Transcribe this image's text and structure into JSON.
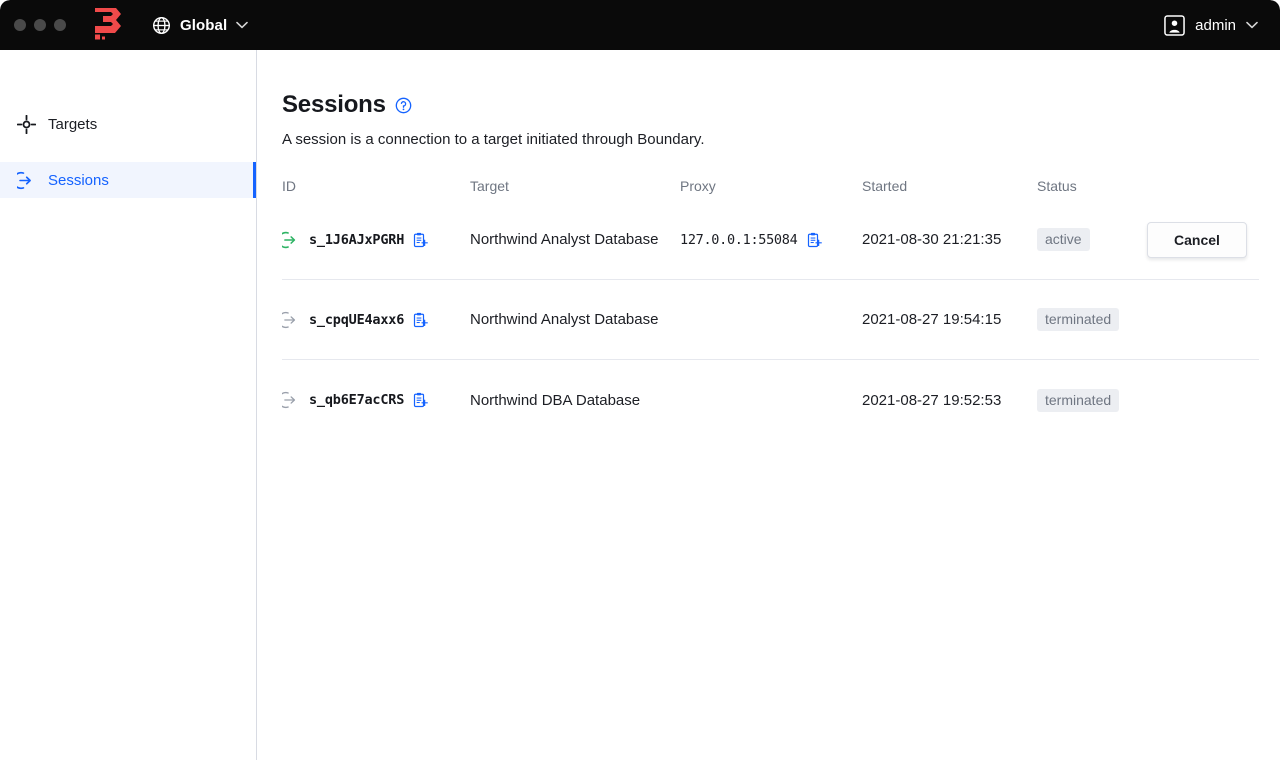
{
  "window": {
    "traffic_lights": [
      "close",
      "minimize",
      "maximize"
    ]
  },
  "topbar": {
    "logo_name": "boundary-logo",
    "logo_color": "#f04a4a",
    "scope": {
      "icon": "globe-icon",
      "label": "Global",
      "chevron": "⌄"
    },
    "user": {
      "icon": "user-avatar-icon",
      "label": "admin",
      "chevron": "⌄"
    },
    "background": "#0a0a0a"
  },
  "sidebar": {
    "items": [
      {
        "label": "Targets",
        "icon": "target-crosshair-icon",
        "active": false
      },
      {
        "label": "Sessions",
        "icon": "session-arrow-icon",
        "active": true
      }
    ],
    "active_color": "#1563ff",
    "active_background": "#f1f5fe"
  },
  "main": {
    "title": "Sessions",
    "help_icon": "help-circle-icon",
    "description": "A session is a connection to a target initiated through Boundary.",
    "table": {
      "columns": [
        "ID",
        "Target",
        "Proxy",
        "Started",
        "Status"
      ],
      "rows": [
        {
          "status_icon": "session-arrow-icon-active",
          "status_icon_color": "#2eb364",
          "id": "s_1J6AJxPGRH",
          "id_copy_icon": "copy-clipboard-icon",
          "target": "Northwind Analyst Database",
          "proxy": "127.0.0.1:55084",
          "proxy_copy_icon": "copy-clipboard-icon",
          "started": "2021-08-30 21:21:35",
          "status": "active",
          "action": "Cancel"
        },
        {
          "status_icon": "session-arrow-icon-terminated",
          "status_icon_color": "#9aa0ab",
          "id": "s_cpqUE4axx6",
          "id_copy_icon": "copy-clipboard-icon",
          "target": "Northwind Analyst Database",
          "proxy": "",
          "proxy_copy_icon": "",
          "started": "2021-08-27 19:54:15",
          "status": "terminated",
          "action": ""
        },
        {
          "status_icon": "session-arrow-icon-terminated",
          "status_icon_color": "#9aa0ab",
          "id": "s_qb6E7acCRS",
          "id_copy_icon": "copy-clipboard-icon",
          "target": "Northwind DBA Database",
          "proxy": "",
          "proxy_copy_icon": "",
          "started": "2021-08-27 19:52:53",
          "status": "terminated",
          "action": ""
        }
      ]
    }
  },
  "colors": {
    "accent_blue": "#1563ff",
    "brand_red": "#f04a4a",
    "active_green": "#2eb364",
    "badge_bg": "#eceef2",
    "badge_text": "#6f7682"
  }
}
